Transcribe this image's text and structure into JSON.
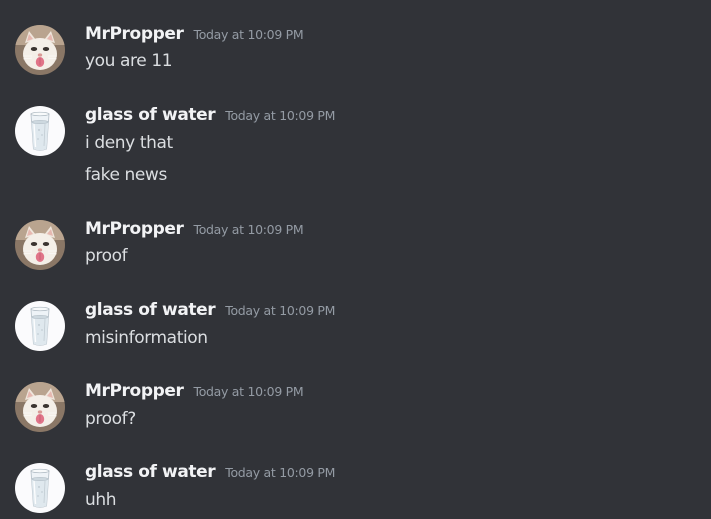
{
  "messages": [
    {
      "author": "MrPropper",
      "avatar": "cat-avatar",
      "timestamp": "Today at 10:09 PM",
      "lines": [
        "you are 11"
      ]
    },
    {
      "author": "glass of water",
      "avatar": "glass-of-water-avatar",
      "timestamp": "Today at 10:09 PM",
      "lines": [
        "i deny that",
        "fake news"
      ]
    },
    {
      "author": "MrPropper",
      "avatar": "cat-avatar",
      "timestamp": "Today at 10:09 PM",
      "lines": [
        "proof"
      ]
    },
    {
      "author": "glass of water",
      "avatar": "glass-of-water-avatar",
      "timestamp": "Today at 10:09 PM",
      "lines": [
        "misinformation"
      ]
    },
    {
      "author": "MrPropper",
      "avatar": "cat-avatar",
      "timestamp": "Today at 10:09 PM",
      "lines": [
        "proof?"
      ]
    },
    {
      "author": "glass of water",
      "avatar": "glass-of-water-avatar",
      "timestamp": "Today at 10:09 PM",
      "lines": [
        "uhh"
      ]
    }
  ],
  "colors": {
    "background": "#313338",
    "username": "#f2f3f5",
    "timestamp": "#949ba4",
    "message_text": "#dbdee1"
  }
}
